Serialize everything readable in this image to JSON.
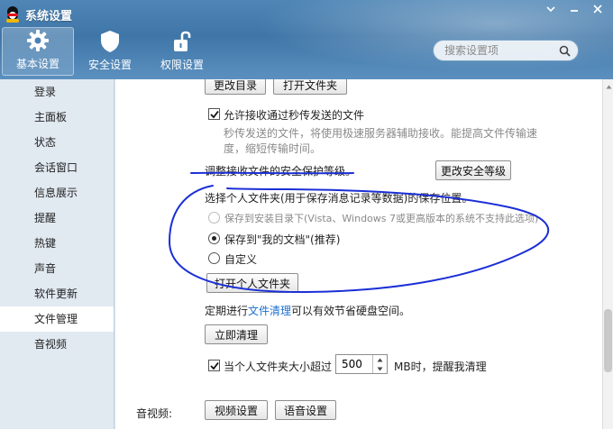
{
  "window": {
    "title": "系统设置"
  },
  "tabs": [
    {
      "label": "基本设置",
      "icon": "gear-icon",
      "active": true
    },
    {
      "label": "安全设置",
      "icon": "shield-icon",
      "active": false
    },
    {
      "label": "权限设置",
      "icon": "lock-icon",
      "active": false
    }
  ],
  "search": {
    "placeholder": "搜索设置项"
  },
  "sidebar": {
    "items": [
      {
        "label": "登录"
      },
      {
        "label": "主面板"
      },
      {
        "label": "状态"
      },
      {
        "label": "会话窗口"
      },
      {
        "label": "信息展示"
      },
      {
        "label": "提醒"
      },
      {
        "label": "热键"
      },
      {
        "label": "声音"
      },
      {
        "label": "软件更新"
      },
      {
        "label": "文件管理",
        "active": true
      },
      {
        "label": "音视频"
      }
    ]
  },
  "content": {
    "change_dir_label": "更改目录",
    "open_folder_label": "打开文件夹",
    "allow_fast_transfer_label": "允许接收通过秒传发送的文件",
    "fast_transfer_desc_1": "秒传发送的文件，将使用极速服务器辅助接收。能提高文件传输速",
    "fast_transfer_desc_2": "度，缩短传输时间。",
    "security_level_text": "调整接收文件的安全保护等级。",
    "change_security_label": "更改安全等级",
    "personal_folder_text": "选择个人文件夹(用于保存消息记录等数据)的保存位置。",
    "radio_install_dir": "保存到安装目录下(Vista、Windows 7或更高版本的系统不支持此选项)",
    "radio_my_docs": "保存到\"我的文档\"(推荐)",
    "radio_custom": "自定义",
    "open_personal_folder_label": "打开个人文件夹",
    "cleanup_prefix": "定期进行",
    "cleanup_link": "文件清理",
    "cleanup_suffix": "可以有效节省硬盘空间。",
    "clean_now_label": "立即清理",
    "size_check_prefix": "当个人文件夹大小超过",
    "size_value": "500",
    "size_check_suffix": "MB时，提醒我清理",
    "av_section_label": "音视频:",
    "video_settings_label": "视频设置",
    "audio_settings_label": "语音设置"
  },
  "colors": {
    "header": "#4a80b2",
    "annotation_ink": "#1b2fd6",
    "link": "#1d6fd0"
  }
}
